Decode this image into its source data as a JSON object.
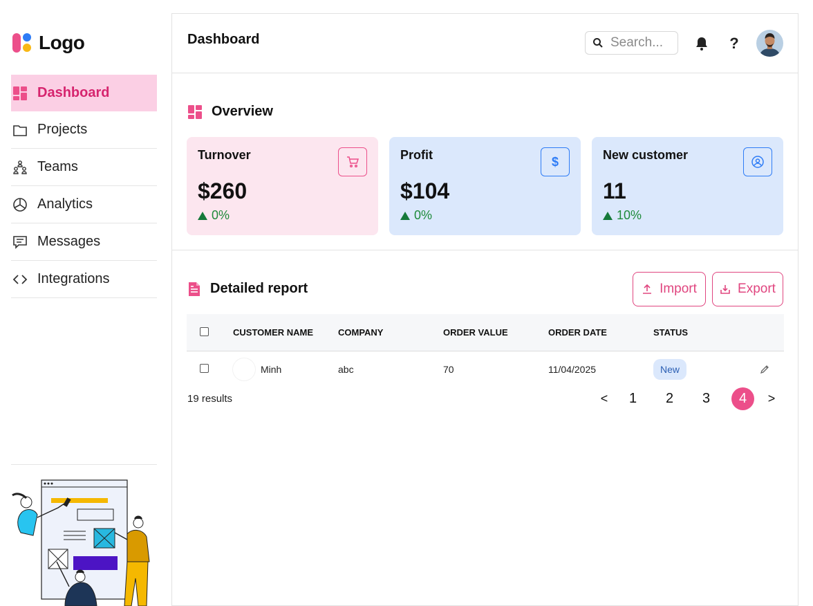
{
  "logo": {
    "text": "Logo"
  },
  "sidebar": {
    "items": [
      {
        "label": "Dashboard",
        "icon": "dashboard-icon",
        "active": true
      },
      {
        "label": "Projects",
        "icon": "folder-icon"
      },
      {
        "label": "Teams",
        "icon": "teams-icon"
      },
      {
        "label": "Analytics",
        "icon": "pie-chart-icon"
      },
      {
        "label": "Messages",
        "icon": "message-icon"
      },
      {
        "label": "Integrations",
        "icon": "code-icon"
      }
    ]
  },
  "header": {
    "title": "Dashboard",
    "search_placeholder": "Search...",
    "icons": [
      "bell-icon",
      "help-icon",
      "avatar"
    ]
  },
  "overview": {
    "title": "Overview",
    "cards": [
      {
        "label": "Turnover",
        "value": "$260",
        "change": "0%",
        "icon": "cart-icon",
        "tone": "#fce6ef"
      },
      {
        "label": "Profit",
        "value": "$104",
        "change": "0%",
        "icon": "dollar-icon",
        "tone": "#dbe8fc"
      },
      {
        "label": "New customer",
        "value": "11",
        "change": "10%",
        "icon": "user-circle-icon",
        "tone": "#dbe8fc"
      }
    ]
  },
  "report": {
    "title": "Detailed report",
    "import_label": "Import",
    "export_label": "Export",
    "columns": [
      "CUSTOMER NAME",
      "COMPANY",
      "ORDER VALUE",
      "ORDER DATE",
      "STATUS"
    ],
    "rows": [
      {
        "name": "Minh",
        "company": "abc",
        "order_value": "70",
        "order_date": "11/04/2025",
        "status": "New"
      }
    ],
    "results": "19 results",
    "pagination": {
      "prev": "<",
      "pages": [
        "1",
        "2",
        "3",
        "4"
      ],
      "current": "4",
      "next": ">"
    }
  },
  "colors": {
    "accent": "#ec4f8a",
    "blue": "#2e7cf6",
    "active_bg": "#fbcfe4",
    "positive": "#1e8a3a"
  }
}
